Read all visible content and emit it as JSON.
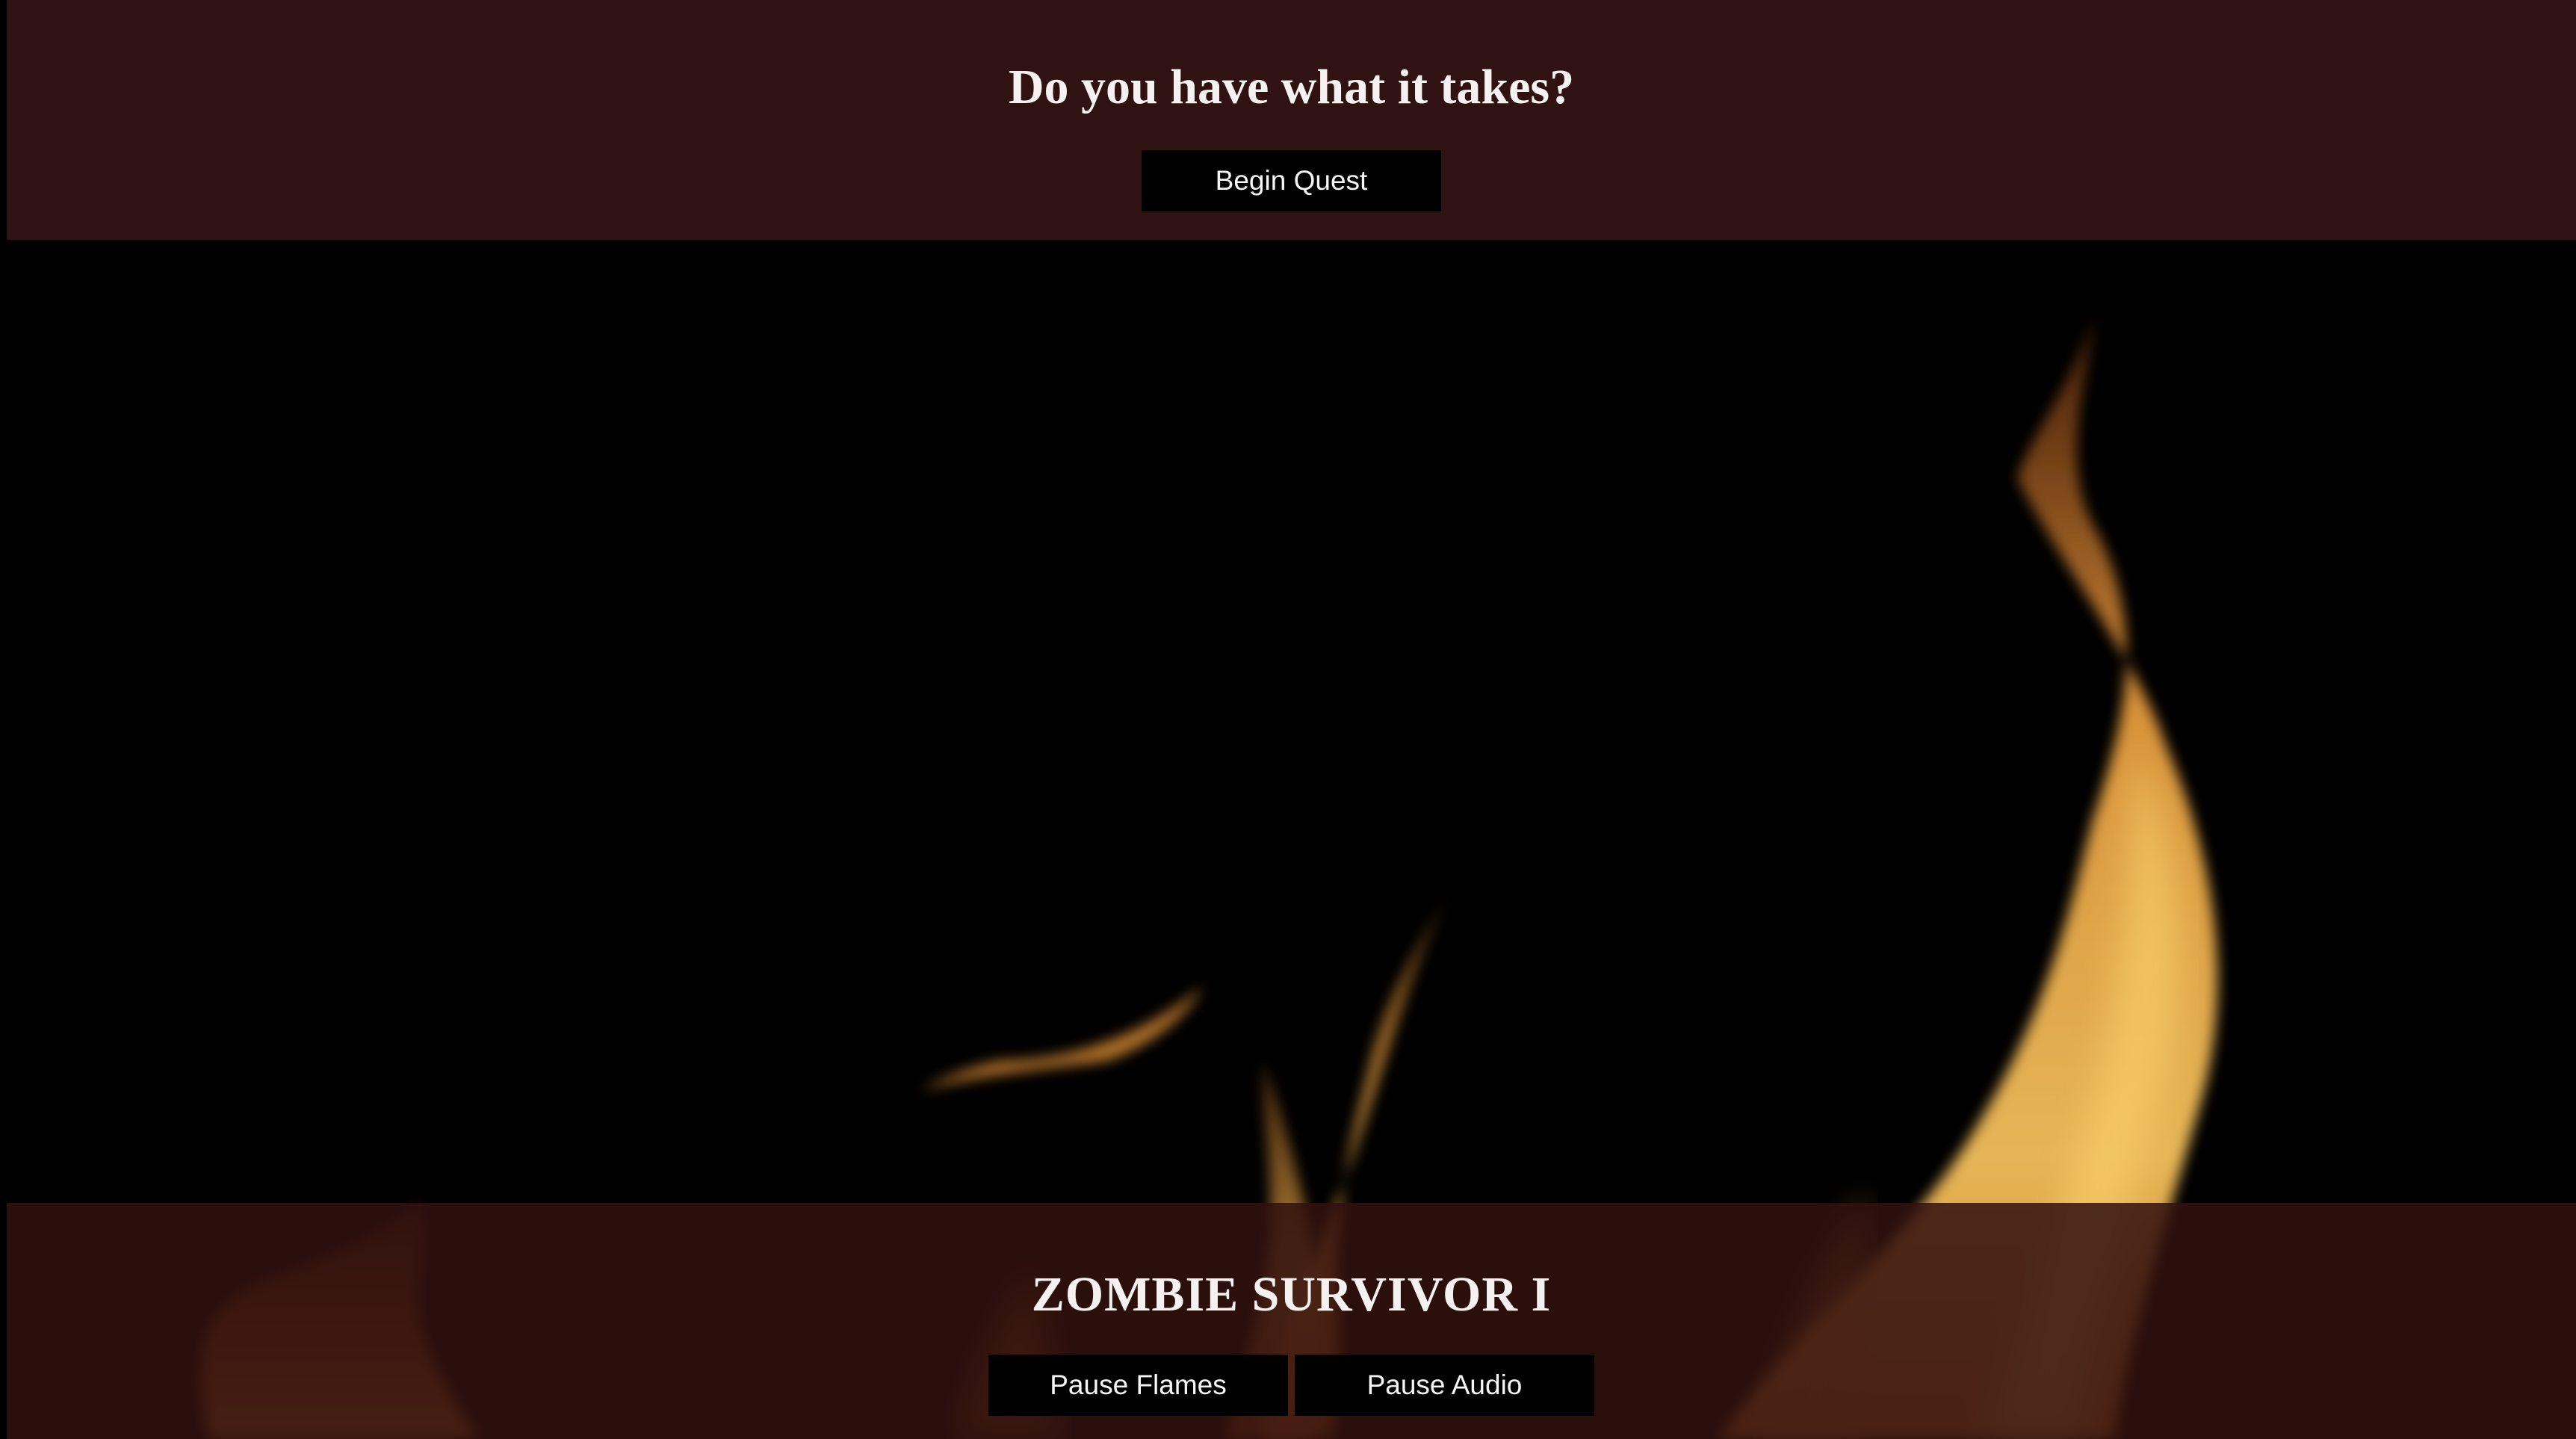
{
  "top": {
    "heading": "Do you have what it takes?",
    "begin_label": "Begin Quest"
  },
  "bottom": {
    "title": "ZOMBIE SURVIVOR I",
    "pause_flames_label": "Pause Flames",
    "pause_audio_label": "Pause Audio"
  },
  "colors": {
    "band": "#2f1211",
    "button_bg": "#000000",
    "flame_core": "#f6c15a",
    "flame_edge": "#c56a1e"
  },
  "icons": [
    "flame-background-video"
  ]
}
